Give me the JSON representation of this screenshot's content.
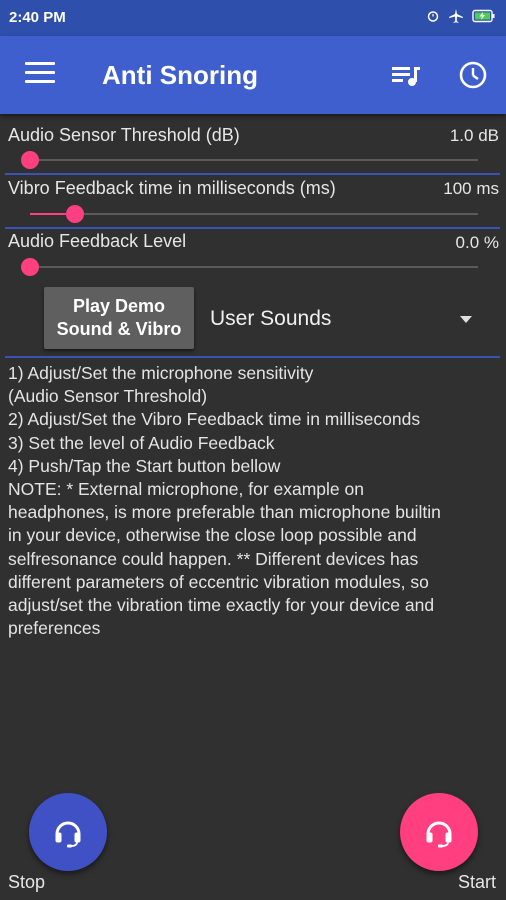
{
  "status_bar": {
    "time": "2:40 PM"
  },
  "app_bar": {
    "title": "Anti Snoring"
  },
  "settings": [
    {
      "label": "Audio Sensor Threshold (dB)",
      "value": "1.0 dB",
      "slider_fraction": 0.0
    },
    {
      "label": "Vibro Feedback time in milliseconds (ms)",
      "value": "100 ms",
      "slider_fraction": 0.1
    },
    {
      "label": "Audio Feedback Level",
      "value": "0.0 %",
      "slider_fraction": 0.0
    }
  ],
  "demo_button": {
    "line1": "Play Demo",
    "line2": "Sound & Vibro"
  },
  "sound_select": {
    "selected": "User Sounds"
  },
  "instructions": [
    "1) Adjust/Set the microphone sensitivity",
    "(Audio Sensor Threshold)",
    "2) Adjust/Set the Vibro Feedback time in milliseconds",
    "3) Set the level of Audio Feedback",
    "4) Push/Tap the Start button bellow",
    "NOTE: * External microphone, for example on",
    "headphones, is more preferable than microphone builtin",
    "in your device, otherwise the close loop possible and",
    "selfresonance could happen. ** Different devices has",
    "different parameters of eccentric vibration modules, so",
    "adjust/set the vibration time exactly for your device and",
    "preferences"
  ],
  "buttons": {
    "stop_label": "Stop",
    "start_label": "Start"
  },
  "colors": {
    "primary": "#3f5fcf",
    "accent": "#ff3f80",
    "background": "#303030"
  }
}
